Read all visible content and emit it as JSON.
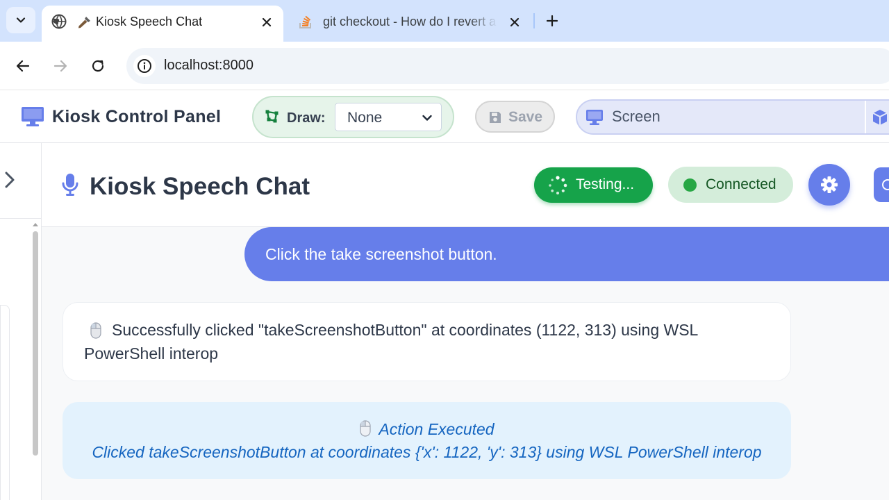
{
  "browser": {
    "tabs": [
      {
        "title": "Kiosk Speech Chat",
        "active": true
      },
      {
        "title": "git checkout - How do I revert a",
        "active": false
      }
    ],
    "address_url": "localhost:8000"
  },
  "app_header": {
    "title": "Kiosk Control Panel",
    "draw_label": "Draw:",
    "draw_selected": "None",
    "save_label": "Save",
    "screen_label": "Screen"
  },
  "chat_header": {
    "title": "Kiosk Speech Chat",
    "testing_label": "Testing...",
    "connected_label": "Connected"
  },
  "messages": {
    "user": "Click the take screenshot button.",
    "assistant_line1": "Successfully clicked \"takeScreenshotButton\" at coordinates (1122, 313) using WSL",
    "assistant_line2": "PowerShell interop",
    "action_title": "Action Executed",
    "action_detail": "Clicked takeScreenshotButton at coordinates {'x': 1122, 'y': 313} using WSL PowerShell interop"
  },
  "colors": {
    "primary": "#667eea",
    "success": "#16a34a",
    "connected_bg": "#d4edda",
    "info_bg": "#e3f2fd",
    "info_text": "#1565c0"
  }
}
